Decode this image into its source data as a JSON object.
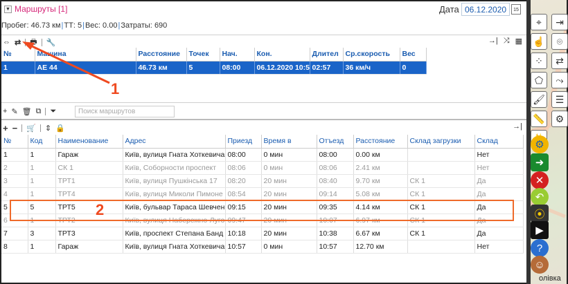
{
  "routes_panel": {
    "title": "Маршруты [1]",
    "date_label": "Дата",
    "date_value": "06.12.2020",
    "calendar_day": "15",
    "summary": {
      "mileage_label": "Пробег:",
      "mileage_value": "46.73 км",
      "points_label": "ТТ:",
      "points_value": "5",
      "weight_label": "Вес:",
      "weight_value": "0.00",
      "cost_label": "Затраты:",
      "cost_value": "690"
    },
    "search_placeholder": "Поиск маршрутов"
  },
  "routes_table": {
    "columns": [
      "№",
      "Машина",
      "Расстояние",
      "Точек",
      "Нач.",
      "Кон.",
      "Длител",
      "Ср.скорость",
      "Вес"
    ],
    "rows": [
      [
        "1",
        "АЕ 44",
        "46.73 км",
        "5",
        "08:00",
        "06.12.2020 10:5",
        "02:57",
        "36 км/ч",
        "0"
      ]
    ]
  },
  "points_table": {
    "columns": [
      "№",
      "Код",
      "Наименование",
      "Адрес",
      "Приезд",
      "Время в",
      "Отъезд",
      "Расстояние",
      "Склад загрузки",
      "Склад"
    ],
    "rows": [
      {
        "style": "blk",
        "cells": [
          "1",
          "1",
          "Гараж",
          "Київ, вулиця Гната Хоткевича",
          "08:00",
          "0 мин",
          "08:00",
          "0.00 км",
          "",
          "Нет"
        ]
      },
      {
        "style": "grey",
        "cells": [
          "2",
          "1",
          "СК 1",
          "Київ, Соборности проспект",
          "08:06",
          "0 мин",
          "08:06",
          "2.41 км",
          "",
          "Нет"
        ]
      },
      {
        "style": "grey",
        "cells": [
          "3",
          "1",
          "ТРТ1",
          "Київ, вулиця Пушкінська 17",
          "08:20",
          "20 мин",
          "08:40",
          "9.70 км",
          "СК 1",
          "Да"
        ]
      },
      {
        "style": "grey",
        "cells": [
          "4",
          "1",
          "ТРТ4",
          "Київ, вулиця Миколи Пимоне",
          "08:54",
          "20 мин",
          "09:14",
          "5.08 км",
          "СК 1",
          "Да"
        ]
      },
      {
        "style": "blk",
        "cells": [
          "5",
          "5",
          "ТРТ5",
          "Київ, бульвар Тараса Шевчен",
          "09:15",
          "20 мин",
          "09:35",
          "4.14 км",
          "СК 1",
          "Да"
        ]
      },
      {
        "style": "grey",
        "cells": [
          "6",
          "1",
          "ТРТ2",
          "Київ, вулиця Набережно-Луго",
          "09:47",
          "20 мин",
          "10:07",
          "6.97 км",
          "СК 1",
          "Да"
        ]
      },
      {
        "style": "blk",
        "cells": [
          "7",
          "3",
          "ТРТ3",
          "Київ, проспект Степана Банд",
          "10:18",
          "20 мин",
          "10:38",
          "6.67 км",
          "СК 1",
          "Да"
        ]
      },
      {
        "style": "blk",
        "cells": [
          "8",
          "1",
          "Гараж",
          "Київ, вулиця Гната Хоткевича",
          "10:57",
          "0 мин",
          "10:57",
          "12.70 км",
          "",
          "Нет"
        ]
      }
    ]
  },
  "annotations": {
    "marker1": "1",
    "marker2": "2"
  },
  "side_panel": {
    "olivka": "олівка"
  }
}
